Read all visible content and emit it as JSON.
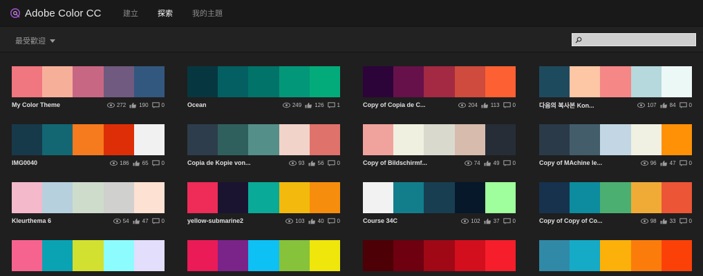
{
  "app": {
    "title": "Adobe Color CC",
    "logo_icon": "adobe-color-wheel-icon"
  },
  "nav": [
    {
      "label": "建立",
      "active": false
    },
    {
      "label": "探索",
      "active": true
    },
    {
      "label": "我的主題",
      "active": false
    }
  ],
  "toolbar": {
    "sort_label": "最受歡迎",
    "search_icon": "search-icon",
    "search_placeholder": "",
    "search_value": ""
  },
  "themes": [
    {
      "name": "My Color Theme",
      "colors": [
        "#f0767f",
        "#f6b09a",
        "#c86784",
        "#705a7f",
        "#33587f"
      ],
      "views": "272",
      "likes": "190",
      "comments": "0"
    },
    {
      "name": "Ocean",
      "colors": [
        "#063740",
        "#045f63",
        "#027368",
        "#03977a",
        "#04ab7a"
      ],
      "views": "249",
      "likes": "126",
      "comments": "1"
    },
    {
      "name": "Copy of Copia de C...",
      "colors": [
        "#2c0439",
        "#66114a",
        "#a32a42",
        "#ce4b3d",
        "#fc6033"
      ],
      "views": "204",
      "likes": "113",
      "comments": "0"
    },
    {
      "name": "다음의 복사본 Kon...",
      "colors": [
        "#1e4a5e",
        "#fdc6a5",
        "#f58787",
        "#b5d9dc",
        "#ecf8f6"
      ],
      "views": "107",
      "likes": "84",
      "comments": "0"
    },
    {
      "name": "IMG0040",
      "colors": [
        "#173a4a",
        "#126773",
        "#f67a1e",
        "#de2e07",
        "#f1f1f2"
      ],
      "views": "186",
      "likes": "65",
      "comments": "0"
    },
    {
      "name": "Copia de Kopie von...",
      "colors": [
        "#2d3d4b",
        "#30605e",
        "#558f8a",
        "#f2d3c9",
        "#df726b"
      ],
      "views": "93",
      "likes": "56",
      "comments": "0"
    },
    {
      "name": "Copy of Bildschirmf...",
      "colors": [
        "#f0a39d",
        "#f0f0e0",
        "#d9dacd",
        "#d7bbac",
        "#262d37"
      ],
      "views": "74",
      "likes": "49",
      "comments": "0"
    },
    {
      "name": "Copy of MAchine le...",
      "colors": [
        "#2a3a48",
        "#435d6b",
        "#c2d7e3",
        "#f0f1e2",
        "#ff9107"
      ],
      "views": "96",
      "likes": "47",
      "comments": "0"
    },
    {
      "name": "Kleurthema 6",
      "colors": [
        "#f5b9cc",
        "#b7d0de",
        "#cedccb",
        "#d0d0cf",
        "#fde1d3"
      ],
      "views": "54",
      "likes": "47",
      "comments": "0"
    },
    {
      "name": "yellow-submarine2",
      "colors": [
        "#ef2b58",
        "#1b1430",
        "#0aaa98",
        "#f3b90c",
        "#f68d0c"
      ],
      "views": "103",
      "likes": "40",
      "comments": "0"
    },
    {
      "name": "Course 34C",
      "colors": [
        "#f2f2f2",
        "#137e8b",
        "#183e51",
        "#06182a",
        "#a0ff9d"
      ],
      "views": "102",
      "likes": "37",
      "comments": "0"
    },
    {
      "name": "Copy of Copy of Co...",
      "colors": [
        "#16324d",
        "#0c8c9e",
        "#4caf72",
        "#f0ab37",
        "#ec5535"
      ],
      "views": "98",
      "likes": "33",
      "comments": "0"
    },
    {
      "name": "",
      "colors": [
        "#f7638f",
        "#09a3b4",
        "#d2e02f",
        "#8dfcfe",
        "#e2defb"
      ],
      "views": "",
      "likes": "",
      "comments": ""
    },
    {
      "name": "",
      "colors": [
        "#ea1b56",
        "#7a248a",
        "#0dc1f4",
        "#87c23b",
        "#efe60b"
      ],
      "views": "",
      "likes": "",
      "comments": ""
    },
    {
      "name": "",
      "colors": [
        "#4d0006",
        "#6e0010",
        "#a00816",
        "#d30e1d",
        "#f51e2a"
      ],
      "views": "",
      "likes": "",
      "comments": ""
    },
    {
      "name": "",
      "colors": [
        "#3189a8",
        "#15aac5",
        "#fcb00a",
        "#fb7c0b",
        "#fc4108"
      ],
      "views": "",
      "likes": "",
      "comments": ""
    }
  ],
  "stat_icons": {
    "views": "eye-icon",
    "likes": "thumbs-up-icon",
    "comments": "comment-icon"
  },
  "colors": {
    "topbar": "#191919",
    "background": "#1f1f1f",
    "accent": "#9b53c2"
  }
}
